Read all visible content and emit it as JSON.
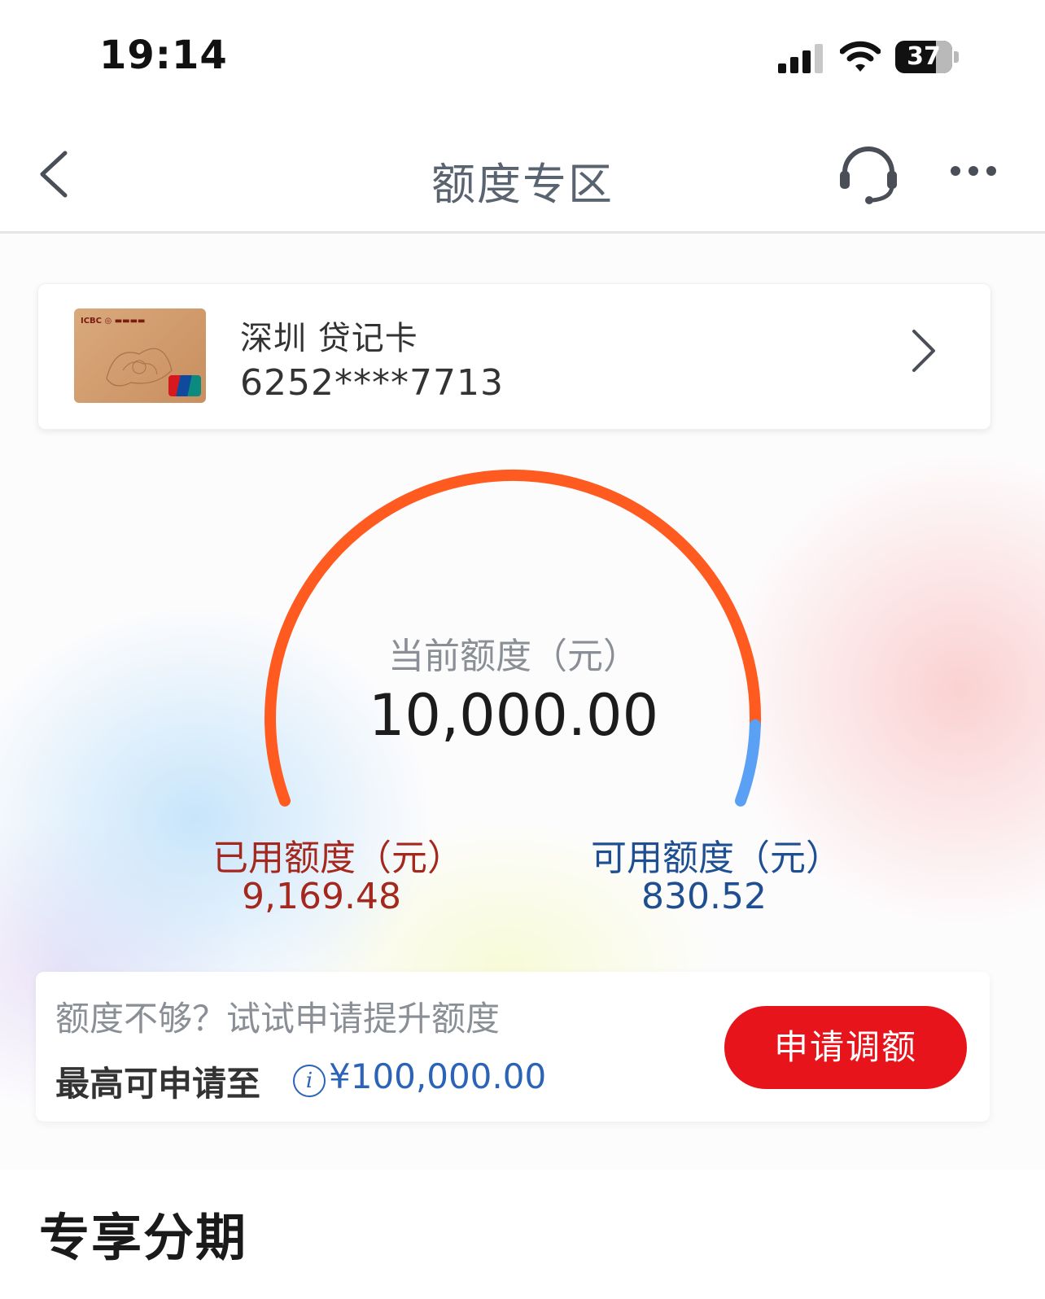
{
  "status_bar": {
    "time": "19:14",
    "battery": "37"
  },
  "nav": {
    "title": "额度专区"
  },
  "card": {
    "name": "深圳 贷记卡",
    "number": "6252****7713"
  },
  "gauge": {
    "label": "当前额度（元）",
    "total": "10,000.00",
    "used_label": "已用额度（元）",
    "used_value": "9,169.48",
    "available_label": "可用额度（元）",
    "available_value": "830.52",
    "used_fraction": 0.9169,
    "colors": {
      "used": "#ff5a1f",
      "available": "#5aa0f5"
    }
  },
  "promo": {
    "hint": "额度不够？试试申请提升额度",
    "max_label": "最高可申请至",
    "max_amount": "¥100,000.00",
    "button_label": "申请调额"
  },
  "section": {
    "title": "专享分期"
  },
  "colors": {
    "accent_red": "#e8141b",
    "link_blue": "#2b63b8"
  }
}
